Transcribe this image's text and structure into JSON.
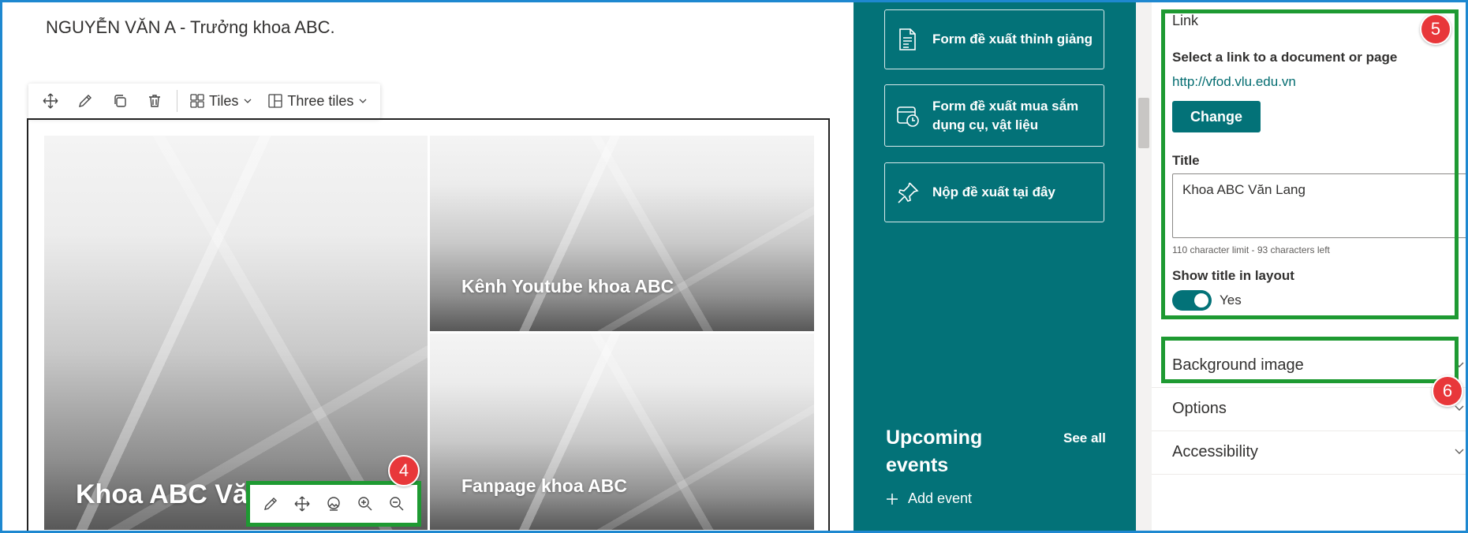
{
  "canvas": {
    "author_line": "NGUYỄN VĂN A - Trưởng khoa ABC.",
    "toolbar": {
      "move_icon": "move-icon",
      "edit_icon": "pencil-icon",
      "duplicate_icon": "copy-icon",
      "delete_icon": "trash-icon",
      "layout_label": "Tiles",
      "tiles_count_label": "Three tiles"
    },
    "tiles": [
      {
        "title": "Khoa ABC Văn Lang"
      },
      {
        "title": "Kênh Youtube khoa ABC"
      },
      {
        "title": "Fanpage khoa ABC"
      }
    ],
    "image_toolbar": [
      "pencil-icon",
      "move-icon",
      "image-icon",
      "zoom-in-icon",
      "zoom-out-icon"
    ]
  },
  "quick_links": [
    {
      "label": "Form đề xuất thỉnh giảng",
      "icon": "document-list-icon"
    },
    {
      "label": "Form đề xuất mua sắm dụng cụ, vật liệu",
      "icon": "calendar-clock-icon"
    },
    {
      "label": "Nộp đề xuất tại đây",
      "icon": "pin-icon"
    }
  ],
  "events": {
    "title": "Upcoming events",
    "see_all": "See all",
    "add_event": "Add event"
  },
  "property_pane": {
    "section_link": "Link",
    "select_label": "Select a link to a document or page",
    "url": "http://vfod.vlu.edu.vn",
    "change_button": "Change",
    "title_label": "Title",
    "title_value": "Khoa ABC Văn Lang",
    "char_limit": "110 character limit - 93 characters left",
    "show_title_label": "Show title in layout",
    "toggle_value": "Yes",
    "toggle_on": true,
    "accordions": [
      "Background image",
      "Options",
      "Accessibility"
    ]
  },
  "badges": [
    "4",
    "5",
    "6"
  ],
  "colors": {
    "teal": "#037278",
    "highlight_green": "#1e9a32",
    "badge_red": "#e8373a",
    "frame_blue": "#1e88d0"
  }
}
